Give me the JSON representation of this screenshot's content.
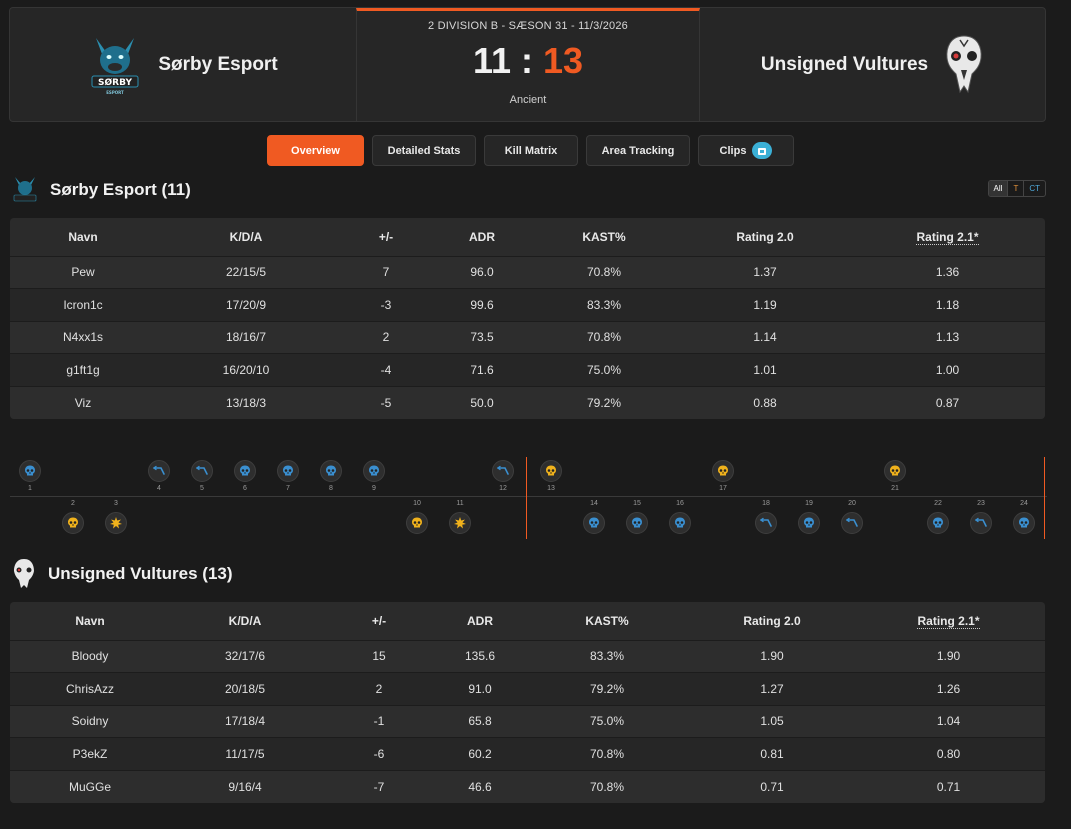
{
  "header": {
    "team_home": "Sørby Esport",
    "team_away": "Unsigned Vultures",
    "match_info": "2 DIVISION B - SÆSON 31 - 11/3/2026",
    "score_home": "11",
    "score_separator": ":",
    "score_away": "13",
    "map": "Ancient",
    "logo_home_text": "SØRBY",
    "logo_home_subtext": "ESPORT"
  },
  "tabs": [
    "Overview",
    "Detailed Stats",
    "Kill Matrix",
    "Area Tracking",
    "Clips"
  ],
  "active_tab": "Overview",
  "side_filter": [
    "All",
    "T",
    "CT"
  ],
  "colors": {
    "accent": "#f05a22",
    "ct_blue": "#3a8fd0",
    "t_yellow": "#f0b21c",
    "clip_badge": "#3bb0d6"
  },
  "team1": {
    "title": "Sørby Esport (11)",
    "columns": [
      "Navn",
      "K/D/A",
      "+/-",
      "ADR",
      "KAST%",
      "Rating 2.0",
      "Rating 2.1*"
    ],
    "rows": [
      [
        "Pew",
        "22/15/5",
        "7",
        "96.0",
        "70.8%",
        "1.37",
        "1.36"
      ],
      [
        "Icron1c",
        "17/20/9",
        "-3",
        "99.6",
        "83.3%",
        "1.19",
        "1.18"
      ],
      [
        "N4xx1s",
        "18/16/7",
        "2",
        "73.5",
        "70.8%",
        "1.14",
        "1.13"
      ],
      [
        "g1ft1g",
        "16/20/10",
        "-4",
        "71.6",
        "75.0%",
        "1.01",
        "1.00"
      ],
      [
        "Viz",
        "13/18/3",
        "-5",
        "50.0",
        "79.2%",
        "0.88",
        "0.87"
      ]
    ]
  },
  "team2": {
    "title": "Unsigned Vultures (13)",
    "columns": [
      "Navn",
      "K/D/A",
      "+/-",
      "ADR",
      "KAST%",
      "Rating 2.0",
      "Rating 2.1*"
    ],
    "rows": [
      [
        "Bloody",
        "32/17/6",
        "15",
        "135.6",
        "83.3%",
        "1.90",
        "1.90"
      ],
      [
        "ChrisAzz",
        "20/18/5",
        "2",
        "91.0",
        "79.2%",
        "1.27",
        "1.26"
      ],
      [
        "Soidny",
        "17/18/4",
        "-1",
        "65.8",
        "75.0%",
        "1.05",
        "1.04"
      ],
      [
        "P3ekZ",
        "11/17/5",
        "-6",
        "60.2",
        "70.8%",
        "0.81",
        "0.80"
      ],
      [
        "MuGGe",
        "9/16/4",
        "-7",
        "46.6",
        "70.8%",
        "0.71",
        "0.71"
      ]
    ]
  },
  "rounds": [
    {
      "n": "1",
      "winner": "top",
      "side": "ct",
      "icon": "skull"
    },
    {
      "n": "2",
      "winner": "bottom",
      "side": "t",
      "icon": "skull"
    },
    {
      "n": "3",
      "winner": "bottom",
      "side": "t",
      "icon": "bomb"
    },
    {
      "n": "4",
      "winner": "top",
      "side": "ct",
      "icon": "defuse"
    },
    {
      "n": "5",
      "winner": "top",
      "side": "ct",
      "icon": "defuse"
    },
    {
      "n": "6",
      "winner": "top",
      "side": "ct",
      "icon": "skull"
    },
    {
      "n": "7",
      "winner": "top",
      "side": "ct",
      "icon": "skull"
    },
    {
      "n": "8",
      "winner": "top",
      "side": "ct",
      "icon": "skull"
    },
    {
      "n": "9",
      "winner": "top",
      "side": "ct",
      "icon": "skull"
    },
    {
      "n": "10",
      "winner": "bottom",
      "side": "t",
      "icon": "skull"
    },
    {
      "n": "11",
      "winner": "bottom",
      "side": "t",
      "icon": "bomb"
    },
    {
      "n": "12",
      "winner": "top",
      "side": "ct",
      "icon": "defuse"
    },
    {
      "n": "13",
      "winner": "top",
      "side": "t",
      "icon": "skull"
    },
    {
      "n": "14",
      "winner": "bottom",
      "side": "ct",
      "icon": "skull"
    },
    {
      "n": "15",
      "winner": "bottom",
      "side": "ct",
      "icon": "skull"
    },
    {
      "n": "16",
      "winner": "bottom",
      "side": "ct",
      "icon": "skull"
    },
    {
      "n": "17",
      "winner": "top",
      "side": "t",
      "icon": "skull"
    },
    {
      "n": "18",
      "winner": "bottom",
      "side": "ct",
      "icon": "defuse"
    },
    {
      "n": "19",
      "winner": "bottom",
      "side": "ct",
      "icon": "skull"
    },
    {
      "n": "20",
      "winner": "bottom",
      "side": "ct",
      "icon": "defuse"
    },
    {
      "n": "21",
      "winner": "top",
      "side": "t",
      "icon": "skull"
    },
    {
      "n": "22",
      "winner": "bottom",
      "side": "ct",
      "icon": "skull"
    },
    {
      "n": "23",
      "winner": "bottom",
      "side": "ct",
      "icon": "defuse"
    },
    {
      "n": "24",
      "winner": "bottom",
      "side": "ct",
      "icon": "skull"
    }
  ]
}
